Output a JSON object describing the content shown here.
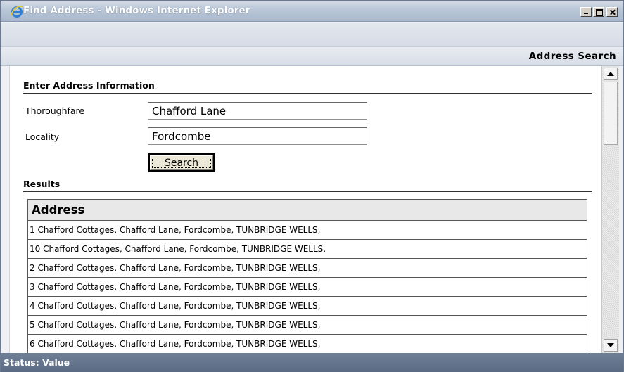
{
  "window": {
    "title": "Find Address - Windows Internet Explorer"
  },
  "header": {
    "title": "Address Search"
  },
  "form": {
    "section_title": "Enter Address Information",
    "thoroughfare_label": "Thoroughfare",
    "thoroughfare_value": "Chafford Lane",
    "locality_label": "Locality",
    "locality_value": "Fordcombe",
    "search_label": "Search"
  },
  "results": {
    "section_title": "Results",
    "column_header": "Address",
    "rows": [
      "1 Chafford Cottages, Chafford Lane, Fordcombe, TUNBRIDGE WELLS,",
      "10 Chafford Cottages, Chafford Lane, Fordcombe, TUNBRIDGE WELLS,",
      "2 Chafford Cottages, Chafford Lane, Fordcombe, TUNBRIDGE WELLS,",
      "3 Chafford Cottages, Chafford Lane, Fordcombe, TUNBRIDGE WELLS,",
      "4 Chafford Cottages, Chafford Lane, Fordcombe, TUNBRIDGE WELLS,",
      "5 Chafford Cottages, Chafford Lane, Fordcombe, TUNBRIDGE WELLS,",
      "6 Chafford Cottages, Chafford Lane, Fordcombe, TUNBRIDGE WELLS,"
    ]
  },
  "status": {
    "text": "Status: Value"
  },
  "icons": {
    "browser": "internet-explorer-icon",
    "minimize": "minimize-icon",
    "maximize": "maximize-icon",
    "close": "close-icon",
    "scroll_up": "scroll-up-arrow-icon",
    "scroll_down": "scroll-down-arrow-icon"
  },
  "colors": {
    "titlebar": "#b9c6d7",
    "statusbar": "#5b6b83",
    "table_header_bg": "#e8e8e8"
  }
}
